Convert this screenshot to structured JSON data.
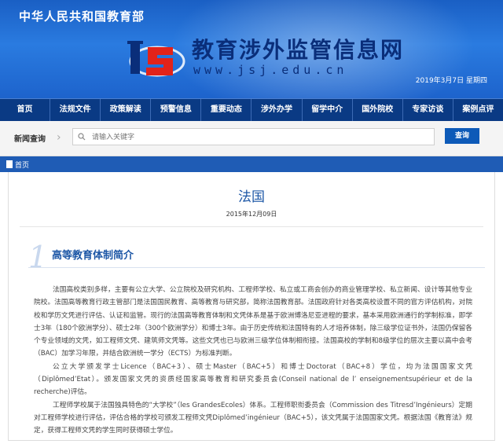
{
  "header": {
    "ministry": "中华人民共和国教育部",
    "site_title": "教育涉外监管信息网",
    "site_url": "www.jsj.edu.cn",
    "date": "2019年3月7日  星期四"
  },
  "nav": {
    "items": [
      "首页",
      "法规文件",
      "政策解读",
      "预警信息",
      "重要动态",
      "涉外办学",
      "留学中介",
      "国外院校",
      "专家访谈",
      "案例点评"
    ]
  },
  "search": {
    "label": "新闻查询",
    "placeholder": "请输入关键字",
    "button": "查询"
  },
  "breadcrumb": {
    "home": "首页"
  },
  "article": {
    "title": "法国",
    "date": "2015年12月09日",
    "section_number": "1",
    "section_title": "高等教育体制简介",
    "paragraphs": [
      "法国高校类别多样，主要有公立大学、公立院校及研究机构、工程师学校、私立或工商会创办的商业管理学校、私立新闻、设计等其他专业院校。法国高等教育行政主管部门是法国国民教育、高等教育与研究部，简称法国教育部。法国政府针对各类高校设置不同的官方评估机构，对院校和学历文凭进行评估、认证和监管。现行的法国高等教育体制和文凭体系是基于欧洲博洛尼亚进程的要求，基本采用欧洲通行的学制标准，即学士3年（180个欧洲学分）、硕士2年（300个欧洲学分）和博士3年。由于历史传统和法国特有的人才培养体制，除三级学位证书外，法国仍保留各个专业领域的文凭，如工程师文凭、建筑师文凭等。这些文凭也已与欧洲三级学位体制相衔接。法国高校的学制和8级学位的层次主要以高中会考（BAC）加学习年限，并结合欧洲统一学分（ECTS）为标准判断。",
      "公立大学颁发学士Licence（BAC+3）、硕士Master（BAC+5）和博士Doctorat（BAC+8）学位，均为法国国家文凭（Diplômed’Etat）。颁发国家文凭的资质经国家高等教育和研究委员会(Conseil national de l’ enseignementsupérieur et de la recherche)评估。",
      "工程师学校属于法国独具特色的“大学校”（les GrandesEcoles）体系。工程师职衔委员会（Commission des Titresd’Ingénieurs）定期对工程师学校进行评估，评估合格的学校可颁发工程师文凭Diplômed’ingénieur（BAC+5），该文凭属于法国国家文凭。根据法国《教育法》规定，获得工程师文凭的学生同时获得硕士学位。"
    ]
  },
  "colors": {
    "banner": "#1a5fc4",
    "nav": "#0a3a84",
    "accent": "#1d57a6",
    "button": "#0d5ab8"
  }
}
